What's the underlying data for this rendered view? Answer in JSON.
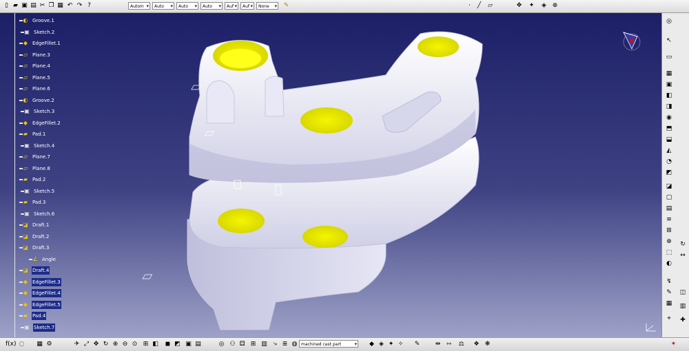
{
  "top_toolbar": {
    "selects": [
      {
        "value": "Autom"
      },
      {
        "value": "Auto"
      },
      {
        "value": "Auto"
      },
      {
        "value": "Auto"
      },
      {
        "value": "Auf"
      },
      {
        "value": "Auf"
      },
      {
        "value": "None"
      }
    ]
  },
  "tree": {
    "items": [
      {
        "label": "Groove.1",
        "icon": "groove-icon"
      },
      {
        "label": "Sketch.2",
        "icon": "sketch-icon"
      },
      {
        "label": "EdgeFillet.1",
        "icon": "edgefillet-icon"
      },
      {
        "label": "Plane.3",
        "icon": "plane-icon"
      },
      {
        "label": "Plane.4",
        "icon": "plane-icon"
      },
      {
        "label": "Plane.5",
        "icon": "plane-icon"
      },
      {
        "label": "Plane.6",
        "icon": "plane-icon"
      },
      {
        "label": "Groove.2",
        "icon": "groove-icon"
      },
      {
        "label": "Sketch.3",
        "icon": "sketch-icon"
      },
      {
        "label": "EdgeFillet.2",
        "icon": "edgefillet-icon"
      },
      {
        "label": "Pad.1",
        "icon": "pad-icon"
      },
      {
        "label": "Sketch.4",
        "icon": "sketch-icon"
      },
      {
        "label": "Plane.7",
        "icon": "plane-icon"
      },
      {
        "label": "Plane.8",
        "icon": "plane-icon"
      },
      {
        "label": "Pad.2",
        "icon": "pad-icon"
      },
      {
        "label": "Sketch.5",
        "icon": "sketch-icon"
      },
      {
        "label": "Pad.3",
        "icon": "pad-icon"
      },
      {
        "label": "Sketch.6",
        "icon": "sketch-icon"
      },
      {
        "label": "Draft.1",
        "icon": "draft-icon"
      },
      {
        "label": "Draft.2",
        "icon": "draft-icon"
      },
      {
        "label": "Draft.3",
        "icon": "draft-icon"
      },
      {
        "label": "Angle",
        "icon": "angle-icon"
      },
      {
        "label": "Draft.4",
        "icon": "draft-icon"
      },
      {
        "label": "EdgeFillet.3",
        "icon": "edgefillet-icon"
      },
      {
        "label": "EdgeFillet.4",
        "icon": "edgefillet-icon"
      },
      {
        "label": "EdgeFillet.5",
        "icon": "edgefillet-icon"
      },
      {
        "label": "Pad.4",
        "icon": "pad-icon"
      },
      {
        "label": "Sketch.7",
        "icon": "sketch-icon"
      }
    ]
  },
  "bottom_toolbar": {
    "material_select": "machined cast part"
  },
  "colors": {
    "viewport_top": "#1c1f66",
    "viewport_bottom": "#9ea2c8",
    "part_body": "#dcdcf0",
    "hole_face": "#ffff00",
    "selection": "#1c2b8a"
  }
}
